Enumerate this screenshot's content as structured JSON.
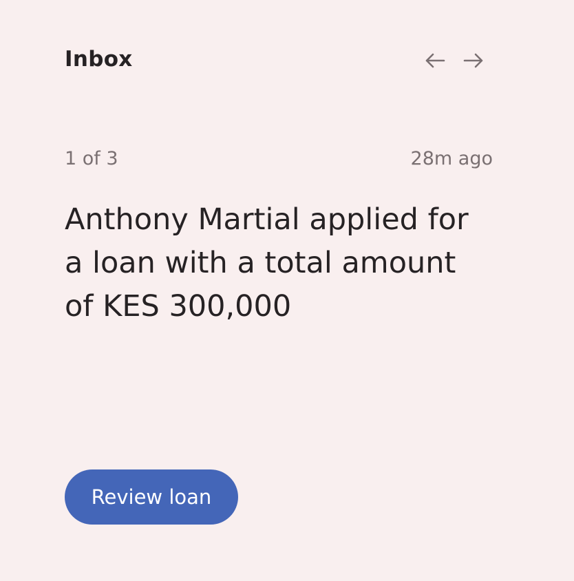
{
  "header": {
    "title": "Inbox",
    "prev_icon": "arrow-left-icon",
    "next_icon": "arrow-right-icon"
  },
  "pagination": {
    "position_text": "1 of 3"
  },
  "notification": {
    "time_ago": "28m ago",
    "message": "Anthony Martial applied for a loan with a total amount of KES 300,000"
  },
  "actions": {
    "review_label": "Review loan"
  },
  "colors": {
    "background": "#f9efef",
    "accent": "#4466b8",
    "text": "#262224",
    "muted": "#7a7072"
  }
}
